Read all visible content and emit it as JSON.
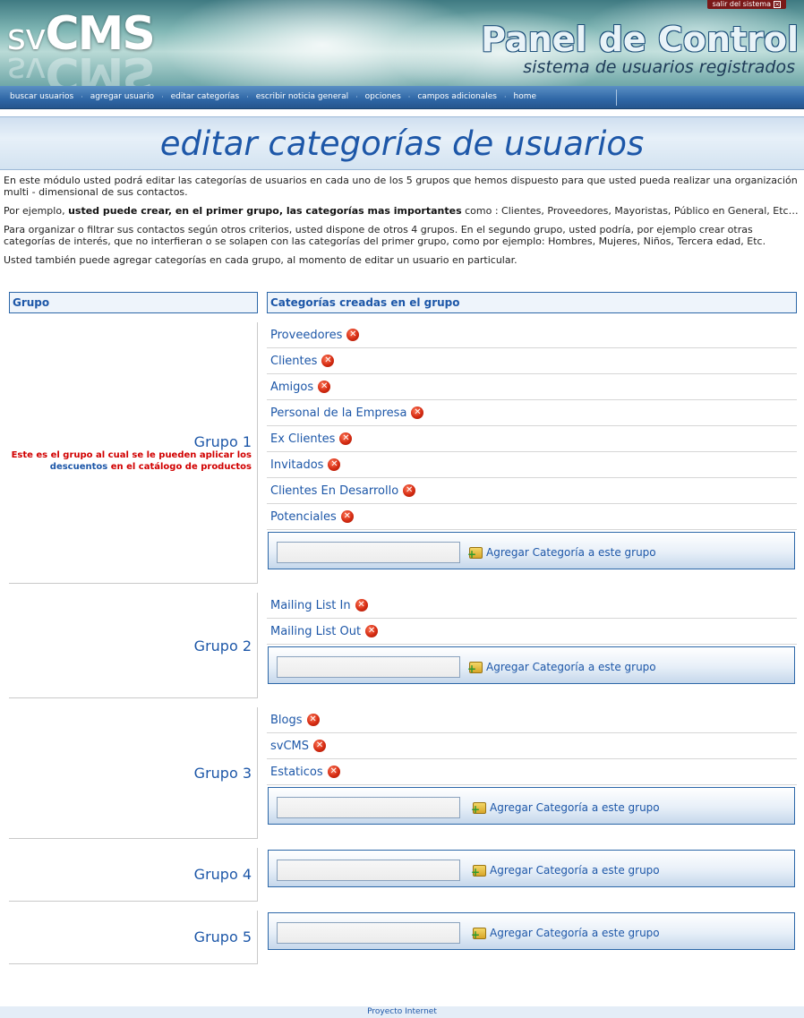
{
  "header": {
    "logo_sv": "sv",
    "logo_cms": "CMS",
    "logout_label": "salir del sistema",
    "panel_title": "Panel de Control",
    "panel_subtitle": "sistema de usuarios registrados"
  },
  "nav": {
    "items": [
      "buscar usuarios",
      "agregar usuario",
      "editar categorías",
      "escribir noticia general",
      "opciones",
      "campos adicionales",
      "home"
    ],
    "separator": "·"
  },
  "page": {
    "title": "editar categorías de usuarios",
    "intro_p1": "En este módulo usted podrá editar las categorías de usuarios en cada uno de los 5 grupos que  hemos dispuesto para que usted pueda realizar una organización multi - dimensional de sus contactos.",
    "intro_p2_pre": "Por ejemplo, ",
    "intro_p2_bold": "usted puede crear, en el primer grupo, las categorías mas importantes",
    "intro_p2_post": " como : Clientes, Proveedores, Mayoristas, Público en General, Etc…",
    "intro_p3": "Para organizar o filtrar sus contactos según otros criterios, usted dispone de otros 4 grupos. En el segundo grupo, usted podría, por ejemplo crear otras categorías de interés, que no interfieran o se solapen con  las categorías del primer grupo, como por ejemplo: Hombres, Mujeres, Niños, Tercera edad, Etc.",
    "intro_p4": "Usted también puede agregar categorías en cada grupo, al momento de editar un usuario en particular."
  },
  "table": {
    "col_group": "Grupo",
    "col_categories": "Categorías creadas en el grupo",
    "add_button_label": "Agregar Categoría a este grupo",
    "add_input_value": "",
    "delete_glyph": "✕"
  },
  "groups": [
    {
      "name": "Grupo 1",
      "note_red_1": "Este es el grupo al cual se le pueden aplicar los",
      "note_blue": "descuentos",
      "note_red_2": " en el catálogo de productos",
      "categories": [
        "Proveedores",
        "Clientes",
        "Amigos",
        "Personal de la Empresa",
        "Ex Clientes",
        "Invitados",
        "Clientes En Desarrollo",
        "Potenciales"
      ]
    },
    {
      "name": "Grupo 2",
      "categories": [
        "Mailing List In",
        "Mailing List Out"
      ]
    },
    {
      "name": "Grupo 3",
      "categories": [
        "Blogs",
        "svCMS",
        "Estaticos"
      ]
    },
    {
      "name": "Grupo 4",
      "categories": []
    },
    {
      "name": "Grupo 5",
      "categories": []
    }
  ],
  "footer": {
    "text": "Proyecto Internet"
  },
  "colors": {
    "accent_blue": "#1d57a8",
    "nav_blue": "#2f67a6",
    "note_red": "#d10000",
    "delete_red": "#d52b12"
  },
  "icons": {
    "delete": "delete-icon",
    "add_folder": "add-folder-icon",
    "logout": "close-icon"
  }
}
